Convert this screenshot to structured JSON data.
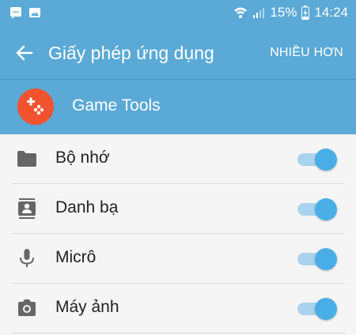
{
  "status_bar": {
    "battery": "15%",
    "time": "14:24",
    "icons": [
      "whatsapp-icon",
      "image-icon",
      "wifi-icon",
      "signal-icon",
      "battery-charging-icon"
    ]
  },
  "app_bar": {
    "title": "Giấy phép ứng dụng",
    "more_label": "NHIỀU HƠN",
    "back_icon": "back-arrow-icon"
  },
  "app_header": {
    "name": "Game Tools",
    "logo_icon": "gamepad-icon",
    "logo_color": "#f1532f"
  },
  "permissions": [
    {
      "label": "Bộ nhớ",
      "icon": "folder-icon",
      "enabled": true
    },
    {
      "label": "Danh bạ",
      "icon": "contacts-icon",
      "enabled": true
    },
    {
      "label": "Micrô",
      "icon": "microphone-icon",
      "enabled": true
    },
    {
      "label": "Máy ảnh",
      "icon": "camera-icon",
      "enabled": true
    }
  ],
  "colors": {
    "header_blue": "#5aa9d6",
    "toggle_thumb": "#4aaee6",
    "toggle_track": "#a9d3ee",
    "list_background": "#f5f5f5"
  }
}
